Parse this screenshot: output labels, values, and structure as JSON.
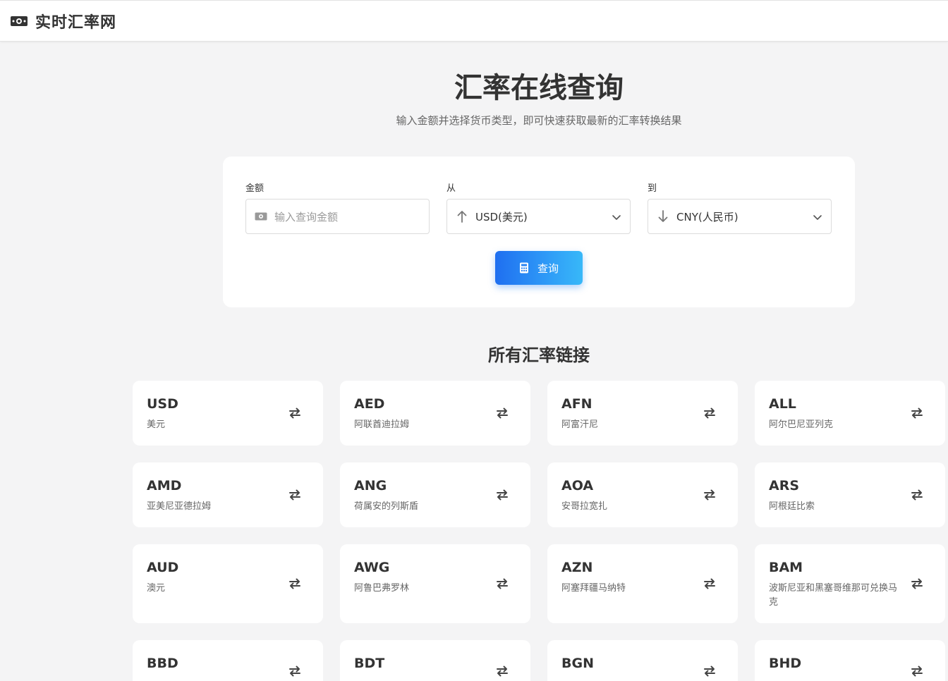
{
  "header": {
    "logo_icon": "money-bill-icon",
    "title": "实时汇率网"
  },
  "hero": {
    "title": "汇率在线查询",
    "subtitle": "输入金额并选择货币类型，即可快速获取最新的汇率转换结果"
  },
  "form": {
    "amount_label": "金额",
    "amount_placeholder": "输入查询金额",
    "amount_icon": "money-bill-icon",
    "from_label": "从",
    "from_value": "USD(美元)",
    "from_icon": "arrow-up-icon",
    "to_label": "到",
    "to_value": "CNY(人民币)",
    "to_icon": "arrow-down-icon",
    "button_label": "查询",
    "button_icon": "calculator-icon",
    "accent": "#1f6ff0"
  },
  "section_title": "所有汇率链接",
  "currencies": [
    {
      "code": "USD",
      "name": "美元"
    },
    {
      "code": "AED",
      "name": "阿联酋迪拉姆"
    },
    {
      "code": "AFN",
      "name": "阿富汗尼"
    },
    {
      "code": "ALL",
      "name": "阿尔巴尼亚列克"
    },
    {
      "code": "AMD",
      "name": "亚美尼亚德拉姆"
    },
    {
      "code": "ANG",
      "name": "荷属安的列斯盾"
    },
    {
      "code": "AOA",
      "name": "安哥拉宽扎"
    },
    {
      "code": "ARS",
      "name": "阿根廷比索"
    },
    {
      "code": "AUD",
      "name": "澳元"
    },
    {
      "code": "AWG",
      "name": "阿鲁巴弗罗林"
    },
    {
      "code": "AZN",
      "name": "阿塞拜疆马纳特"
    },
    {
      "code": "BAM",
      "name": "波斯尼亚和黑塞哥维那可兑换马克"
    },
    {
      "code": "BBD",
      "name": ""
    },
    {
      "code": "BDT",
      "name": ""
    },
    {
      "code": "BGN",
      "name": ""
    },
    {
      "code": "BHD",
      "name": ""
    }
  ]
}
